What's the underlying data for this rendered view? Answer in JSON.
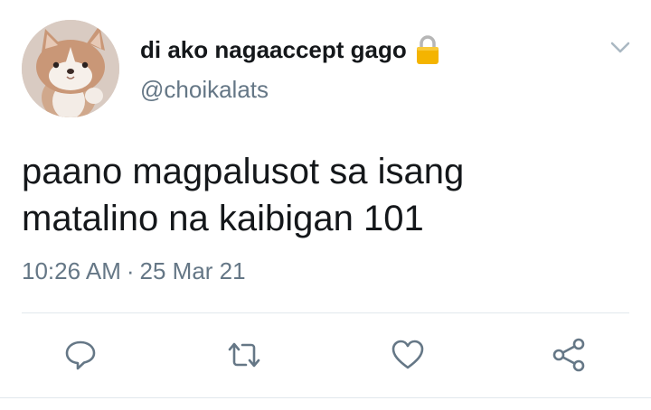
{
  "tweet": {
    "display_name": "di ako nagaaccept gago",
    "handle": "@choikalats",
    "text_line_1": "paano magpalusot sa isang",
    "text_line_2": "matalino na kaibigan 101",
    "time": "10:26 AM",
    "separator": "·",
    "date": "25 Mar 21"
  },
  "icons": {
    "avatar": "avatar",
    "lock": "lock-icon",
    "caret": "chevron-down-icon",
    "reply": "reply-icon",
    "retweet": "retweet-icon",
    "like": "heart-icon",
    "share": "share-icon"
  },
  "colors": {
    "text_primary": "#14171a",
    "text_secondary": "#657786",
    "icon": "#657786",
    "divider": "#e1e8ed",
    "lock": "#f4b400"
  }
}
